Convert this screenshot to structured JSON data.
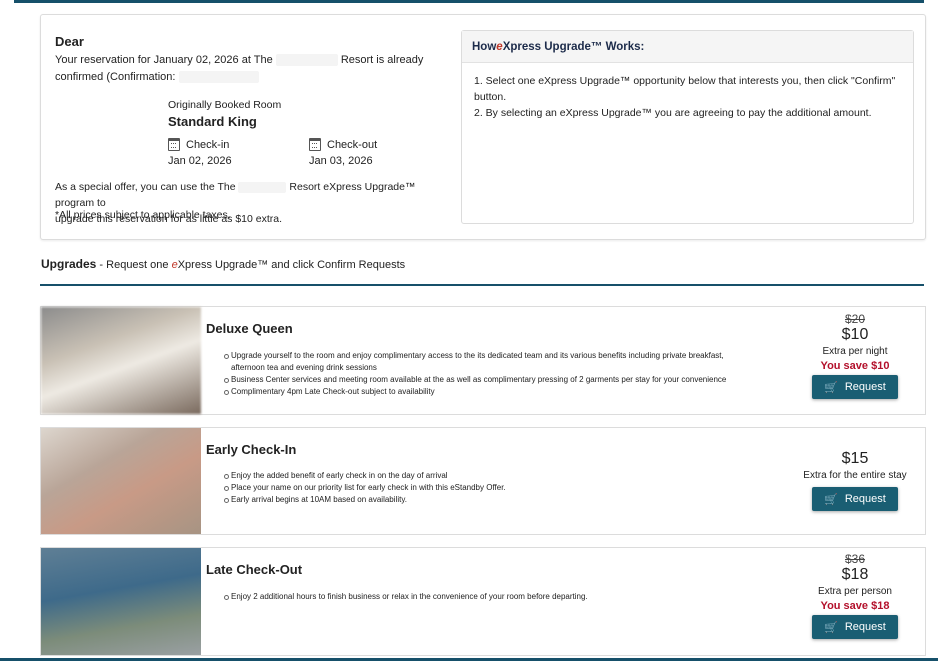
{
  "summary": {
    "dear": "Dear",
    "reservation_prefix": "Your reservation for January 02, 2026 at The",
    "reservation_mid": "Resort is already",
    "confirmed_prefix": "confirmed (Confirmation:",
    "orig_label": "Originally Booked Room",
    "orig_room": "Standard King",
    "checkin_label": "Check-in",
    "checkin_date": "Jan 02, 2026",
    "checkout_label": "Check-out",
    "checkout_date": "Jan 03, 2026",
    "offer_prefix": "As a special offer, you can use the The",
    "offer_mid": "Resort eXpress Upgrade™ program to",
    "offer_line2": "upgrade this reservation for as little as $10 extra.",
    "taxes": "*All prices subject to applicable taxes."
  },
  "how": {
    "title_prefix": "How ",
    "title_e": "e",
    "title_suffix": "Xpress Upgrade™ Works:",
    "step1": "1. Select one eXpress Upgrade™ opportunity below that interests you, then click \"Confirm\" button.",
    "step2": "2. By selecting an eXpress Upgrade™ you are agreeing to pay the additional amount."
  },
  "upgrades_header": {
    "title": "Upgrades",
    "sep": " - Request one ",
    "e": "e",
    "rest": "Xpress Upgrade™ and click Confirm Requests"
  },
  "upgrades": [
    {
      "title": "Deluxe Queen",
      "bullets": [
        "Upgrade yourself to the room and enjoy complimentary access to the its dedicated team and its various benefits including private breakfast, afternoon tea and evening drink sessions",
        "Business Center services and meeting room available at the as well as complimentary pressing of 2 garments per stay for your convenience",
        "Complimentary 4pm Late Check-out subject to availability"
      ],
      "old_price": "$20",
      "price": "$10",
      "per": "Extra per night",
      "save": "You save $10",
      "button": "Request"
    },
    {
      "title": "Early Check-In",
      "bullets": [
        "Enjoy the added benefit of early check in on the day of arrival",
        "Place your name on our priority list for early check in with this eStandby Offer.",
        "Early arrival begins at 10AM based on availability."
      ],
      "price": "$15",
      "per": "Extra for the entire stay",
      "button": "Request"
    },
    {
      "title": "Late Check-Out",
      "bullets": [
        "Enjoy 2 additional hours to finish business or relax in the convenience of your room before departing."
      ],
      "old_price": "$36",
      "price": "$18",
      "per": "Extra per person",
      "save": "You save $18",
      "button": "Request"
    }
  ],
  "colors": {
    "accent": "#1a5e73",
    "save_red": "#b3102b",
    "e_red": "#c0392b"
  }
}
